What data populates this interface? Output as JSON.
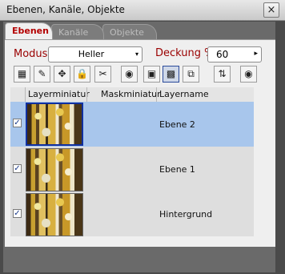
{
  "window": {
    "title": "Ebenen, Kanäle, Objekte",
    "close_glyph": "×"
  },
  "tabs": [
    {
      "label": "Ebenen",
      "active": true
    },
    {
      "label": "Kanäle",
      "active": false
    },
    {
      "label": "Objekte",
      "active": false
    }
  ],
  "mode": {
    "label": "Modus",
    "value": "Heller",
    "arrow": "▾"
  },
  "opacity": {
    "label": "Deckung %",
    "value": "60",
    "arrow": "▸"
  },
  "toolbar": [
    {
      "icon": "pattern-icon",
      "glyph": "▦"
    },
    {
      "icon": "edit-icon",
      "glyph": "✎"
    },
    {
      "icon": "move-icon",
      "glyph": "✥"
    },
    {
      "icon": "lock-icon",
      "glyph": "🔒"
    },
    {
      "icon": "scissors-icon",
      "glyph": "✂"
    },
    {
      "icon": "eye-icon",
      "glyph": "◉"
    },
    {
      "icon": "layer-image-icon",
      "glyph": "▣"
    },
    {
      "icon": "layer-mask-icon",
      "glyph": "▩"
    },
    {
      "icon": "mask-link-icon",
      "glyph": "⧉"
    },
    {
      "icon": "swap-icon",
      "glyph": "⇅"
    },
    {
      "icon": "eye-visibility-icon",
      "glyph": "◉"
    }
  ],
  "table": {
    "headers": [
      "Layerminiatur",
      "Maskminiatur",
      "Layername"
    ],
    "rows": [
      {
        "name": "Ebene 2",
        "visible": true,
        "selected": true,
        "check": "✓"
      },
      {
        "name": "Ebene 1",
        "visible": true,
        "selected": false,
        "check": "✓"
      },
      {
        "name": "Hintergrund",
        "visible": true,
        "selected": false,
        "check": "✓"
      }
    ]
  }
}
